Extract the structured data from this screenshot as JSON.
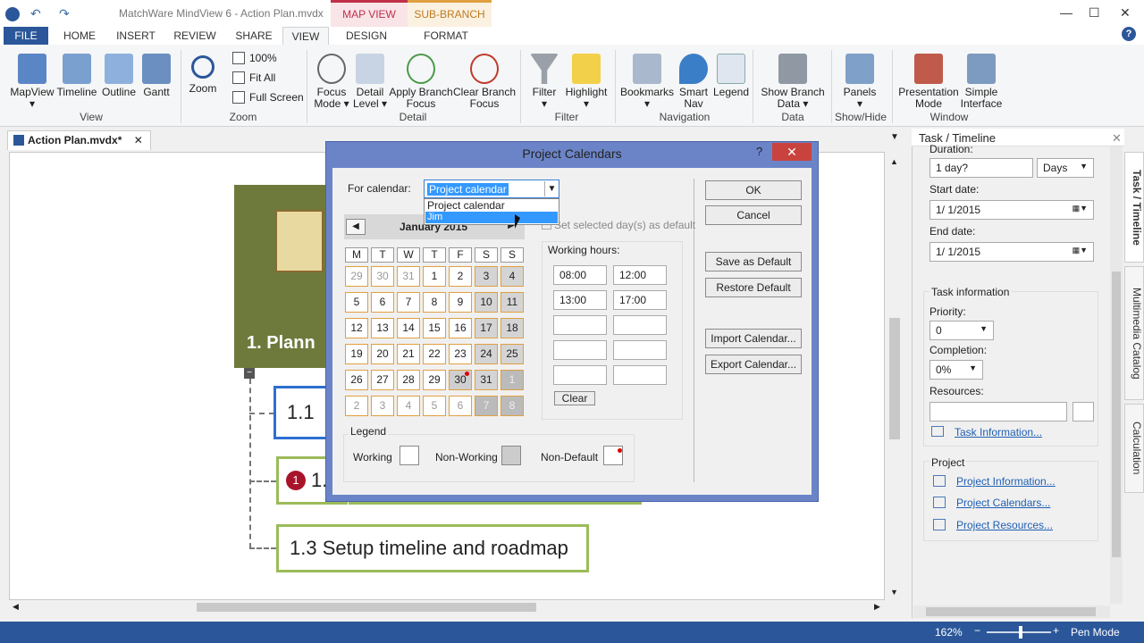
{
  "window": {
    "title": "MatchWare MindView 6 - Action Plan.mvdx",
    "ctx_map": "MAP VIEW",
    "ctx_sub": "SUB-BRANCH"
  },
  "tabs": [
    "FILE",
    "HOME",
    "INSERT",
    "REVIEW",
    "SHARE",
    "VIEW",
    "DESIGN",
    "FORMAT"
  ],
  "ribbon": {
    "view": [
      {
        "l1": "MapView",
        "l2": ""
      },
      {
        "l1": "Timeline",
        "l2": ""
      },
      {
        "l1": "Outline",
        "l2": ""
      },
      {
        "l1": "Gantt",
        "l2": ""
      }
    ],
    "zoom": {
      "zoom": "Zoom",
      "p100": "100%",
      "fit": "Fit All",
      "full": "Full Screen"
    },
    "detail": [
      {
        "l1": "Focus",
        "l2": "Mode ▾"
      },
      {
        "l1": "Detail",
        "l2": "Level ▾"
      },
      {
        "l1": "Apply Branch",
        "l2": "Focus"
      },
      {
        "l1": "Clear Branch",
        "l2": "Focus"
      }
    ],
    "filter": [
      {
        "l1": "Filter",
        "l2": "▾"
      },
      {
        "l1": "Highlight",
        "l2": "▾"
      }
    ],
    "nav": [
      {
        "l1": "Bookmarks",
        "l2": "▾"
      },
      {
        "l1": "Smart",
        "l2": "Nav"
      },
      {
        "l1": "Legend",
        "l2": ""
      }
    ],
    "data": [
      {
        "l1": "Show Branch",
        "l2": "Data ▾"
      }
    ],
    "show": [
      {
        "l1": "Panels",
        "l2": "▾"
      }
    ],
    "window": [
      {
        "l1": "Presentation",
        "l2": "Mode"
      },
      {
        "l1": "Simple",
        "l2": "Interface"
      }
    ],
    "groups": [
      "View",
      "Zoom",
      "Detail",
      "Filter",
      "Navigation",
      "Data",
      "Show/Hide",
      "Window"
    ]
  },
  "doc": {
    "tab": "Action Plan.mvdx*",
    "root": "1.  Plann",
    "n11": "1.1",
    "n12": "1.",
    "n13": "1.3  Setup timeline and roadmap",
    "badge": "1"
  },
  "panel": {
    "title": "Task / Timeline",
    "duration_label": "Duration:",
    "duration": "1 day?",
    "days": "Days",
    "start_label": "Start date:",
    "start": "1/  1/2015",
    "end_label": "End date:",
    "end": "1/  1/2015",
    "taskinfo": "Task information",
    "priority_label": "Priority:",
    "priority": "0",
    "completion_label": "Completion:",
    "completion": "0%",
    "resources_label": "Resources:",
    "taskinfo_link": "Task Information...",
    "project": "Project",
    "proj_info": "Project Information...",
    "proj_cal": "Project Calendars...",
    "proj_res": "Project Resources..."
  },
  "vtabs": [
    "Task / Timeline",
    "Multimedia Catalog",
    "Calculation"
  ],
  "dialog": {
    "title": "Project Calendars",
    "for_label": "For calendar:",
    "selected": "Project calendar",
    "options": [
      "Project calendar",
      "Jim"
    ],
    "month": "January 2015",
    "set_default": "Set selected day(s) as default",
    "working_hours": "Working hours:",
    "hours": [
      [
        "08:00",
        "12:00"
      ],
      [
        "13:00",
        "17:00"
      ]
    ],
    "clear": "Clear",
    "legend": "Legend",
    "working": "Working",
    "nonworking": "Non-Working",
    "nondefault": "Non-Default",
    "buttons": [
      "OK",
      "Cancel",
      "Save as Default",
      "Restore Default",
      "Import Calendar...",
      "Export Calendar..."
    ],
    "days": [
      "M",
      "T",
      "W",
      "T",
      "F",
      "S",
      "S"
    ],
    "weeks": [
      [
        "29",
        "30",
        "31",
        "1",
        "2",
        "3",
        "4"
      ],
      [
        "5",
        "6",
        "7",
        "8",
        "9",
        "10",
        "11"
      ],
      [
        "12",
        "13",
        "14",
        "15",
        "16",
        "17",
        "18"
      ],
      [
        "19",
        "20",
        "21",
        "22",
        "23",
        "24",
        "25"
      ],
      [
        "26",
        "27",
        "28",
        "29",
        "30",
        "31",
        "1"
      ],
      [
        "2",
        "3",
        "4",
        "5",
        "6",
        "7",
        "8"
      ]
    ]
  },
  "status": {
    "zoom": "162%",
    "mode": "Pen Mode"
  }
}
